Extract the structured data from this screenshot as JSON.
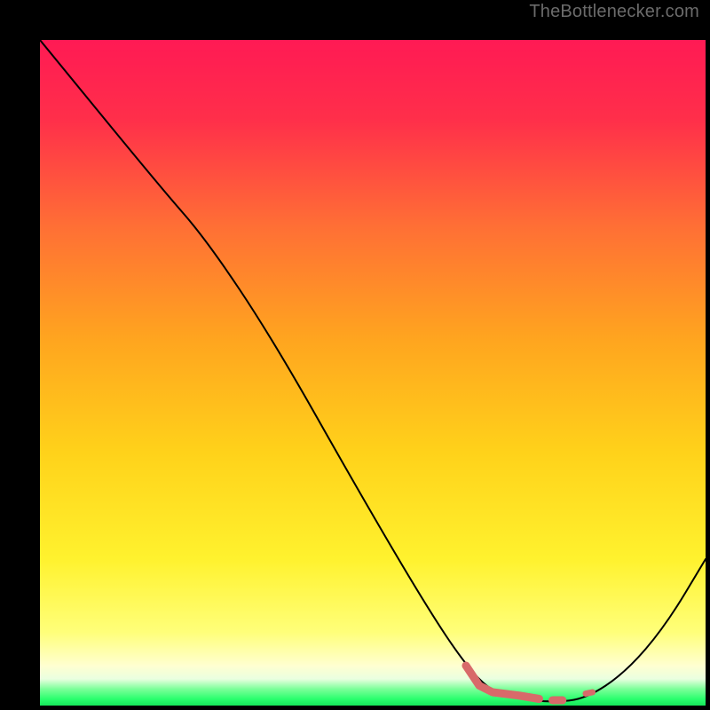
{
  "watermark": "TheBottlenecker.com",
  "chart_data": {
    "type": "line",
    "title": "",
    "xlabel": "",
    "ylabel": "",
    "xlim": [
      0,
      100
    ],
    "ylim": [
      0,
      100
    ],
    "grid": false,
    "series": [
      {
        "name": "curve",
        "color": "#000000",
        "width": 2,
        "points": [
          {
            "x": 0,
            "y": 100
          },
          {
            "x": 18,
            "y": 78
          },
          {
            "x": 25,
            "y": 70
          },
          {
            "x": 35,
            "y": 55
          },
          {
            "x": 48,
            "y": 32
          },
          {
            "x": 58,
            "y": 15
          },
          {
            "x": 64,
            "y": 6
          },
          {
            "x": 68,
            "y": 2
          },
          {
            "x": 72,
            "y": 1
          },
          {
            "x": 77,
            "y": 0.5
          },
          {
            "x": 82,
            "y": 1
          },
          {
            "x": 88,
            "y": 5
          },
          {
            "x": 94,
            "y": 12
          },
          {
            "x": 100,
            "y": 22
          }
        ]
      },
      {
        "name": "highlight",
        "color": "#d86a6a",
        "width": 9,
        "points": [
          {
            "x": 64,
            "y": 6
          },
          {
            "x": 66,
            "y": 3
          },
          {
            "x": 68,
            "y": 2
          },
          {
            "x": 72,
            "y": 1.5
          },
          {
            "x": 75,
            "y": 1
          }
        ]
      },
      {
        "name": "highlight-dot-1",
        "color": "#d86a6a",
        "width": 9,
        "points": [
          {
            "x": 77,
            "y": 0.8
          },
          {
            "x": 78.5,
            "y": 0.8
          }
        ]
      },
      {
        "name": "highlight-dot-2",
        "color": "#d86a6a",
        "width": 7,
        "points": [
          {
            "x": 82,
            "y": 1.8
          },
          {
            "x": 83,
            "y": 2.0
          }
        ]
      }
    ],
    "background_gradient": {
      "stops": [
        {
          "pct": 0,
          "color": "#ff1a54"
        },
        {
          "pct": 12,
          "color": "#ff2f4a"
        },
        {
          "pct": 28,
          "color": "#ff6f35"
        },
        {
          "pct": 45,
          "color": "#ffa51f"
        },
        {
          "pct": 62,
          "color": "#ffd21a"
        },
        {
          "pct": 78,
          "color": "#fff22e"
        },
        {
          "pct": 89,
          "color": "#ffff7a"
        },
        {
          "pct": 94,
          "color": "#ffffd0"
        },
        {
          "pct": 96,
          "color": "#eaffe0"
        },
        {
          "pct": 97.5,
          "color": "#7dff9a"
        },
        {
          "pct": 99,
          "color": "#2bff6e"
        },
        {
          "pct": 100,
          "color": "#16e85a"
        }
      ]
    }
  }
}
